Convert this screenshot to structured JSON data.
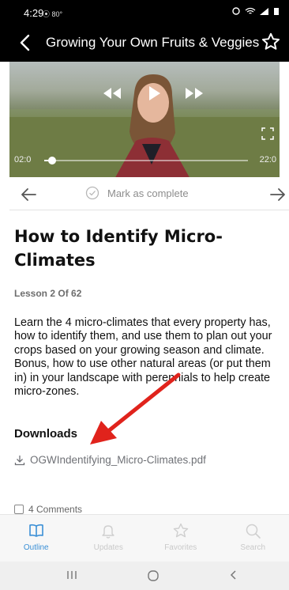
{
  "status_bar": {
    "time": "4:29",
    "extra": "⦿ 80°"
  },
  "header": {
    "title": "Growing Your Own Fruits & Veggies"
  },
  "video": {
    "elapsed": "02:0",
    "duration": "22:0",
    "progress": 0.04
  },
  "lesson_nav": {
    "mark_complete": "Mark as complete"
  },
  "lesson": {
    "title": "How to Identify Micro-Climates",
    "count": "Lesson 2 Of 62",
    "description": "Learn the 4 micro-climates that every property has, how to identify them, and use them to plan out your crops based on your growing season and climate. Bonus, how to use other natural areas (or put them in) in your landscape with perennials to help create micro-zones."
  },
  "downloads": {
    "heading": "Downloads",
    "file_name": "OGWIndentifying_Micro-Climates.pdf"
  },
  "comments": {
    "label": "4 Comments"
  },
  "tabs": {
    "outline": "Outline",
    "updates": "Updates",
    "favorites": "Favorites",
    "search": "Search"
  },
  "colors": {
    "accent": "#3a8fd6",
    "arrow": "#e0231c"
  },
  "icons": [
    "back-arrow-icon",
    "star-icon",
    "rewind-icon",
    "play-icon",
    "forward-icon",
    "fullscreen-icon",
    "arrow-left-icon",
    "check-circle-icon",
    "arrow-right-icon",
    "download-icon",
    "book-icon",
    "bell-icon",
    "star-icon",
    "search-icon"
  ]
}
